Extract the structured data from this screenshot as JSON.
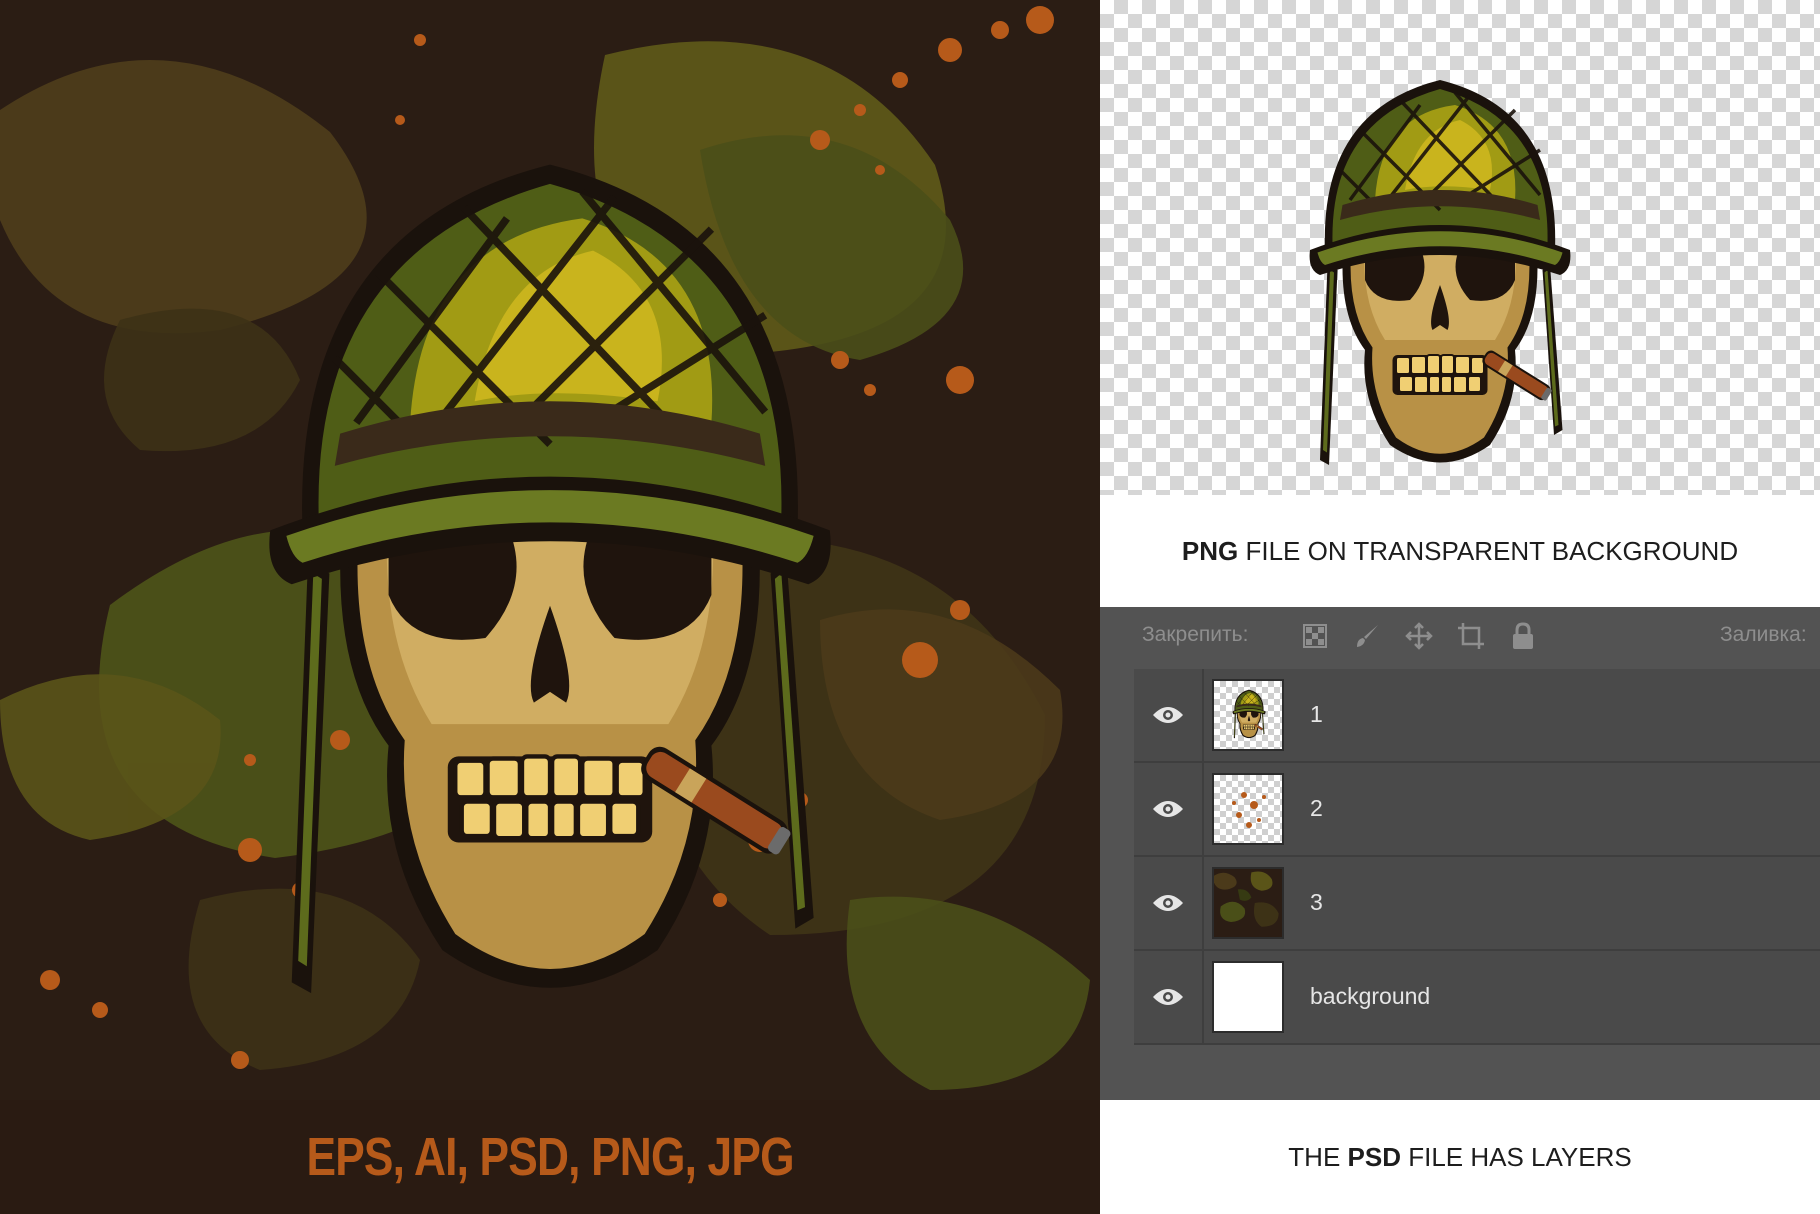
{
  "artwork": {
    "formats_label": "EPS, AI, PSD, PNG, JPG"
  },
  "png_preview": {
    "caption_bold": "PNG",
    "caption_rest": " FILE ON TRANSPARENT BACKGROUND"
  },
  "layers_panel": {
    "lock_label": "Закрепить:",
    "fill_label": "Заливка:",
    "lock_icons": [
      "checkerboard-lock-icon",
      "brush-lock-icon",
      "move-lock-icon",
      "crop-lock-icon",
      "padlock-icon"
    ],
    "layers": [
      {
        "name": "1",
        "visible": true,
        "thumb": "skull"
      },
      {
        "name": "2",
        "visible": true,
        "thumb": "splatter"
      },
      {
        "name": "3",
        "visible": true,
        "thumb": "camo"
      },
      {
        "name": "background",
        "visible": true,
        "thumb": "white"
      }
    ]
  },
  "psd_caption": {
    "prefix": "THE ",
    "bold": "PSD",
    "suffix": " FILE HAS LAYERS"
  },
  "colors": {
    "orange_accent": "#b65a1a",
    "camo_dark": "#2b1d14",
    "helmet_green": "#5d6b1c",
    "skull_tan": "#c9a45a",
    "panel_gray": "#535353"
  }
}
